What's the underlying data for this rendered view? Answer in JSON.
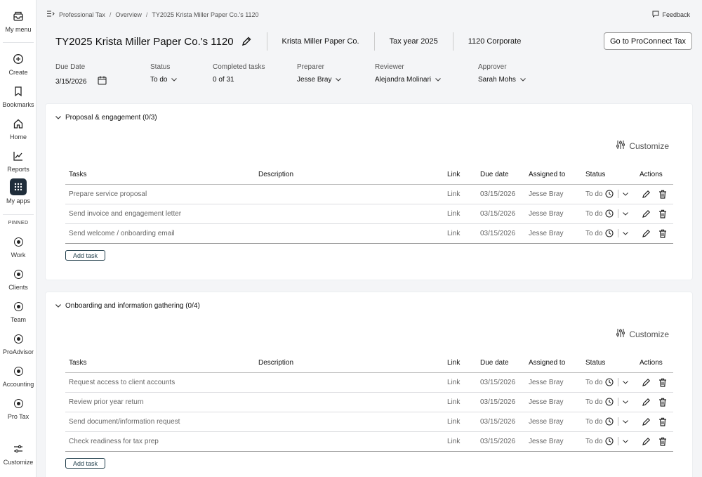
{
  "sidebar": {
    "items": [
      {
        "label": "My menu",
        "icon": "inbox-icon"
      },
      {
        "label": "Create",
        "icon": "plus-circle-icon"
      },
      {
        "label": "Bookmarks",
        "icon": "bookmark-icon"
      },
      {
        "label": "Home",
        "icon": "home-icon"
      },
      {
        "label": "Reports",
        "icon": "chart-line-icon"
      },
      {
        "label": "My apps",
        "icon": "grid-icon"
      }
    ],
    "pinned_label": "PINNED",
    "pinned": [
      {
        "label": "Work",
        "icon": "work-icon"
      },
      {
        "label": "Clients",
        "icon": "clients-icon"
      },
      {
        "label": "Team",
        "icon": "team-icon"
      },
      {
        "label": "ProAdvisor",
        "icon": "proadvisor-icon"
      },
      {
        "label": "Accounting",
        "icon": "accounting-icon"
      },
      {
        "label": "Pro Tax",
        "icon": "pro-tax-icon"
      }
    ],
    "customize_label": "Customize"
  },
  "breadcrumb": [
    "Professional Tax",
    "Overview",
    "TY2025 Krista Miller Paper Co.'s 1120"
  ],
  "feedback_label": "Feedback",
  "header": {
    "title": "TY2025 Krista Miller Paper Co.'s 1120",
    "client": "Krista Miller Paper Co.",
    "tax_year": "Tax year 2025",
    "form": "1120 Corporate",
    "goto_button": "Go to ProConnect Tax"
  },
  "fields": {
    "due_date": {
      "label": "Due Date",
      "value": "3/15/2026"
    },
    "status": {
      "label": "Status",
      "value": "To do"
    },
    "completed": {
      "label": "Completed tasks",
      "value": "0 of 31"
    },
    "preparer": {
      "label": "Preparer",
      "value": "Jesse Bray"
    },
    "reviewer": {
      "label": "Reviewer",
      "value": "Alejandra Molinari"
    },
    "approver": {
      "label": "Approver",
      "value": "Sarah Mohs"
    }
  },
  "customize_label": "Customize",
  "add_task_label": "Add task",
  "columns": [
    "Tasks",
    "Description",
    "Link",
    "Due date",
    "Assigned to",
    "Status",
    "Actions"
  ],
  "sections": [
    {
      "title": "Proposal & engagement (0/3)",
      "rows": [
        {
          "task": "Prepare service proposal",
          "description": "",
          "link": "Link",
          "due": "03/15/2026",
          "assigned": "Jesse Bray",
          "status": "To do"
        },
        {
          "task": "Send invoice and engagement letter",
          "description": "",
          "link": "Link",
          "due": "03/15/2026",
          "assigned": "Jesse Bray",
          "status": "To do"
        },
        {
          "task": "Send welcome / onboarding email",
          "description": "",
          "link": "Link",
          "due": "03/15/2026",
          "assigned": "Jesse Bray",
          "status": "To do"
        }
      ]
    },
    {
      "title": "Onboarding and information gathering (0/4)",
      "rows": [
        {
          "task": "Request access to client accounts",
          "description": "",
          "link": "Link",
          "due": "03/15/2026",
          "assigned": "Jesse Bray",
          "status": "To do"
        },
        {
          "task": "Review prior year return",
          "description": "",
          "link": "Link",
          "due": "03/15/2026",
          "assigned": "Jesse Bray",
          "status": "To do"
        },
        {
          "task": "Send document/information request",
          "description": "",
          "link": "Link",
          "due": "03/15/2026",
          "assigned": "Jesse Bray",
          "status": "To do"
        },
        {
          "task": "Check readiness for tax prep",
          "description": "",
          "link": "Link",
          "due": "03/15/2026",
          "assigned": "Jesse Bray",
          "status": "To do"
        }
      ]
    }
  ]
}
